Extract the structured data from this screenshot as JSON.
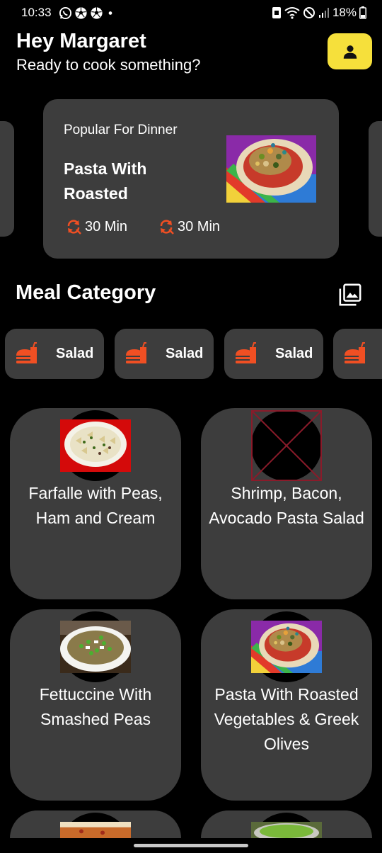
{
  "status_bar": {
    "time": "10:33",
    "battery": "18%",
    "icons": [
      "whatsapp-icon",
      "soccer-ball-icon",
      "soccer-ball-icon",
      "dot-icon",
      "screenshot-icon",
      "wifi-icon",
      "do-not-disturb-icon",
      "signal-icon",
      "battery-icon"
    ]
  },
  "header": {
    "greeting": "Hey Margaret",
    "subtitle": "Ready to cook something?",
    "profile_icon": "person-icon",
    "profile_color": "#f6e03b"
  },
  "popular": {
    "label": "Popular For Dinner",
    "title": "Pasta With Roasted",
    "meta": [
      {
        "icon": "timer-refresh-icon",
        "text": "30 Min"
      },
      {
        "icon": "timer-refresh-icon",
        "text": "30 Min"
      }
    ]
  },
  "categories": {
    "title": "Meal Category",
    "action_icon": "gallery-icon",
    "chips": [
      {
        "icon": "burger-drink-icon",
        "label": "Salad"
      },
      {
        "icon": "burger-drink-icon",
        "label": "Salad"
      },
      {
        "icon": "burger-drink-icon",
        "label": "Salad"
      },
      {
        "icon": "burger-drink-icon",
        "label": ""
      }
    ]
  },
  "meals": [
    {
      "name": "Farfalle with Peas, Ham and Cream",
      "image": "farfalle"
    },
    {
      "name": "Shrimp, Bacon, Avocado Pasta Salad",
      "image": "broken"
    },
    {
      "name": "Fettuccine With Smashed Peas",
      "image": "fettuccine"
    },
    {
      "name": "Pasta With Roasted Vegetables & Greek Olives",
      "image": "pasta-roasted"
    },
    {
      "name": "",
      "image": "pizza"
    },
    {
      "name": "",
      "image": "salad-bowl"
    }
  ],
  "colors": {
    "background": "#000000",
    "card": "#3d3d3d",
    "accent": "#f04f23",
    "profile": "#f6e03b"
  }
}
